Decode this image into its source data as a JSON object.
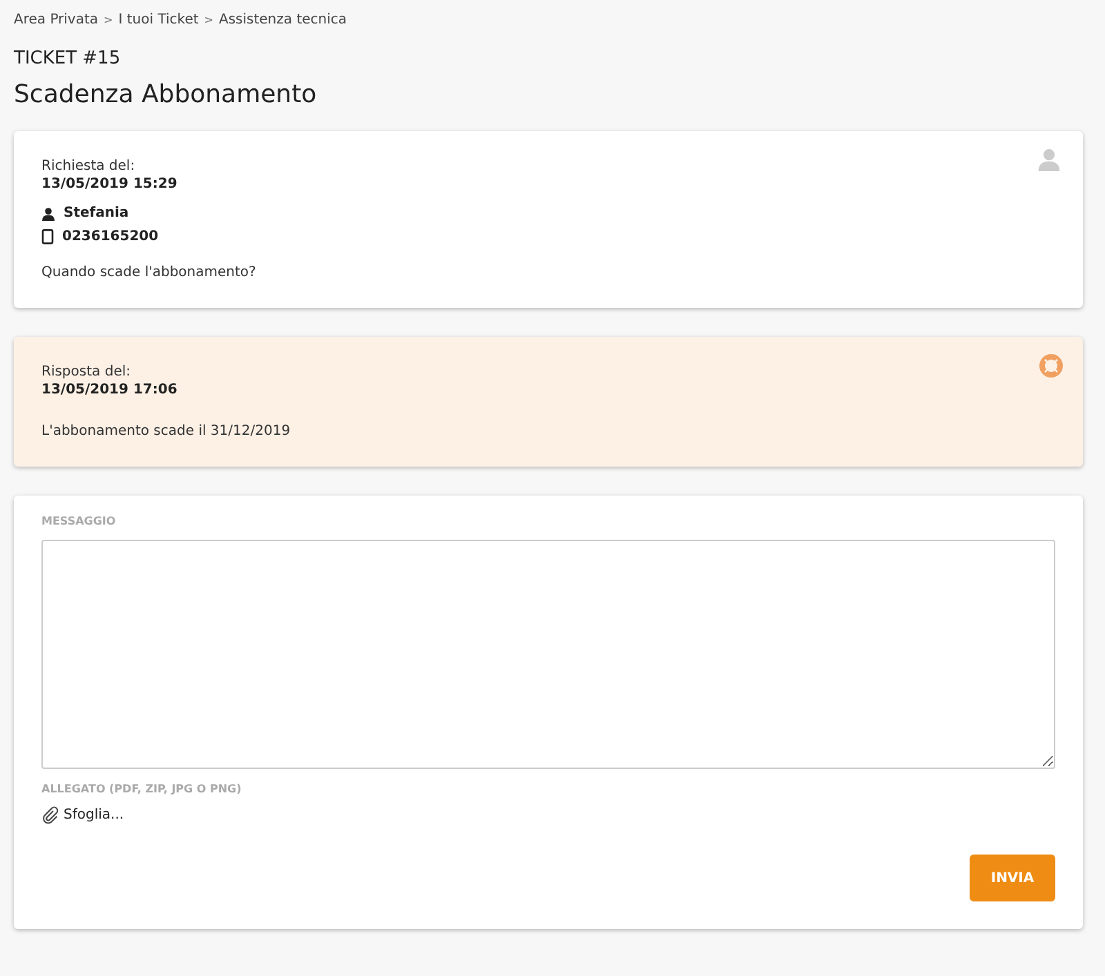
{
  "breadcrumb": [
    {
      "label": "Area Privata"
    },
    {
      "separator": ">",
      "label": "I tuoi Ticket"
    },
    {
      "separator": ">",
      "label": "Assistenza tecnica"
    }
  ],
  "ticket_number": "TICKET #15",
  "title": "Scadenza Abbonamento",
  "messages": [
    {
      "kind": "request",
      "date_label": "Richiesta del:",
      "date": "13/05/2019 15:29",
      "author": "Stefania",
      "phone": "0236165200",
      "text": "Quando scade l'abbonamento?"
    },
    {
      "kind": "reply",
      "date_label": "Risposta del:",
      "date": "13/05/2019 17:06",
      "text": "L'abbonamento scade il 31/12/2019"
    }
  ],
  "form": {
    "message_label": "MESSAGGIO",
    "attachment_label": "ALLEGATO (PDF, ZIP, JPG O PNG)",
    "browse": "Sfoglia...",
    "submit": "INVIA"
  }
}
